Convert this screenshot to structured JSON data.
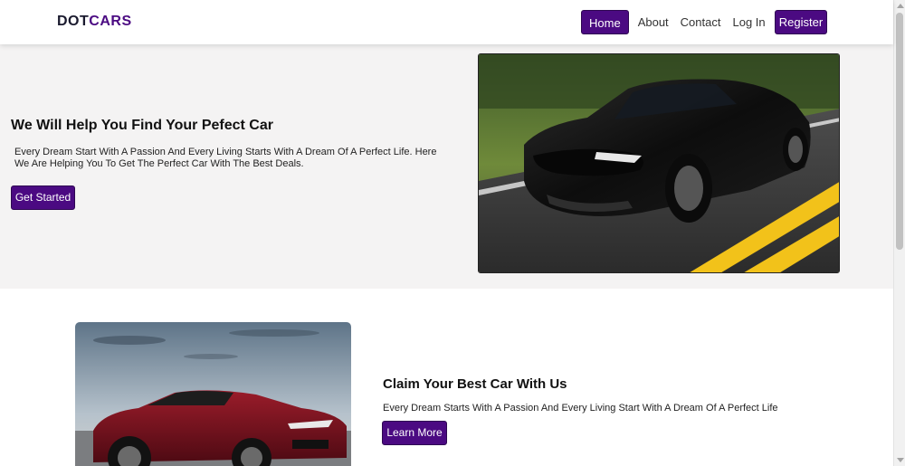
{
  "brand": {
    "logo_part1": "DOT",
    "logo_part2": "CARS",
    "accent": "#4b0a82"
  },
  "nav": {
    "home": "Home",
    "about": "About",
    "contact": "Contact",
    "login": "Log In",
    "register": "Register"
  },
  "hero": {
    "title": "We Will Help You Find Your Pefect Car",
    "text": "Every Dream Start With A Passion And Every Living Starts With A Dream Of A Perfect Life. Here We Are Helping You To Get The Perfect Car With The Best Deals.",
    "cta": "Get Started",
    "image": "black-sports-car-photo"
  },
  "section2": {
    "title": "Claim Your Best Car With Us",
    "text": "Every Dream Starts With A Passion And Every Living Start With A Dream Of A Perfect Life",
    "cta": "Learn More",
    "image": "red-convertible-car-photo"
  }
}
